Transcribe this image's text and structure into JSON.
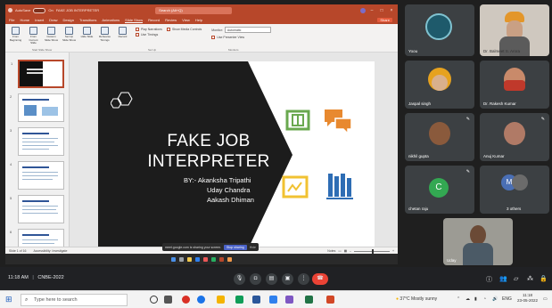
{
  "window": {
    "titlebar_autosave": "AutoSave",
    "titlebar_toggle": "On",
    "doc_title": "FAKE JOB INTERPRETER",
    "search_placeholder": "Search (Alt+Q)",
    "share_label": "Share",
    "menu_tabs": [
      "File",
      "Home",
      "Insert",
      "Draw",
      "Design",
      "Transitions",
      "Animations",
      "Slide Show",
      "Record",
      "Review",
      "View",
      "Help"
    ],
    "active_tab": "Slide Show"
  },
  "ribbon": {
    "buttons": [
      {
        "label": "From Beginning"
      },
      {
        "label": "From Current Slide"
      },
      {
        "label": "Custom Slide Show"
      },
      {
        "label": "Set Up Slide Show"
      },
      {
        "label": "Hide Slide"
      },
      {
        "label": "Rehearse Timings"
      },
      {
        "label": "Record"
      }
    ],
    "checks": [
      "Play Narrations",
      "Use Timings",
      "Show Media Controls"
    ],
    "monitor_label": "Monitor:",
    "monitor_value": "Automatic",
    "presenter_view": "Use Presenter View",
    "groups": [
      "Start Slide Show",
      "Set Up",
      "Monitors"
    ]
  },
  "slides": {
    "numbers": [
      "1",
      "2",
      "3",
      "4",
      "5",
      "6",
      "7"
    ]
  },
  "slide": {
    "title_line1": "FAKE JOB",
    "title_line2": "INTERPRETER",
    "by_line1": "BY:- Akanksha Tripathi",
    "by_line2": "Uday Chandra",
    "by_line3": "Aakash Dhiman"
  },
  "statusbar": {
    "slide_info": "Slide 1 of 16",
    "accessibility": "Accessibility: Investigate",
    "notes": "Notes"
  },
  "share_toast": {
    "message": "meet.google.com is sharing your screen.",
    "stop_label": "Stop sharing",
    "hide_label": "Hide"
  },
  "participants": [
    {
      "name": "Yoou"
    },
    {
      "name": "Dr. Balmeet S. Arora"
    },
    {
      "name": "Jaspal singh"
    },
    {
      "name": "Dr. Rakesh Kumar"
    },
    {
      "name": "nikhil gupta"
    },
    {
      "name": "Anuj Kumar"
    },
    {
      "name": "chetan raju",
      "initial": "C"
    },
    {
      "name": "3 others",
      "initial": "M"
    },
    {
      "name": "Uday"
    }
  ],
  "meet": {
    "time": "11:18 AM",
    "separator": "|",
    "meeting_name": "CNBE-2022"
  },
  "windows": {
    "search_placeholder": "Type here to search",
    "weather": "37°C  Mostly sunny",
    "language": "ENG",
    "clock_time": "11:18",
    "clock_date": "23-05-2022"
  },
  "colors": {
    "ppt_accent": "#b7472a",
    "green_icon": "#6aa84f",
    "orange_icon": "#e8892f",
    "yellow_icon": "#f1c232",
    "blue_icon": "#2e6db4",
    "end_call": "#ea4335"
  }
}
